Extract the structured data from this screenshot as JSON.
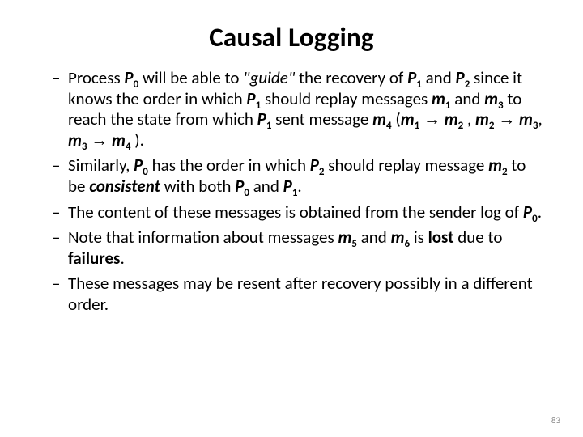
{
  "title": "Causal Logging",
  "bullets": [
    {
      "t": [
        "Process ",
        "<b><i>P</i></b>",
        "<span class=\"sub\"><b>0</b></span>",
        " will be able to ",
        "<i>\"guide\"</i>",
        " the recovery of ",
        "<b><i>P</i></b>",
        "<span class=\"sub\"><b>1</b></span>",
        " and ",
        "<b><i>P</i></b>",
        "<span class=\"sub\"><b>2</b></span>",
        " since it knows the order in which ",
        "<b><i>P</i></b>",
        "<span class=\"sub\"><b>1</b></span>",
        " should replay messages ",
        "<b><i>m</i></b>",
        "<span class=\"sub\"><b>1</b></span>",
        " and ",
        "<b><i>m</i></b>",
        "<span class=\"sub\"><b>3</b></span>",
        " to reach the state from which ",
        "<b><i>P</i></b>",
        "<span class=\"sub\"><b>1</b></span>",
        " sent message ",
        "<b><i>m</i></b>",
        "<span class=\"sub\"><b>4</b></span>",
        " (",
        "<b><i>m</i></b>",
        "<span class=\"sub\"><b>1</b></span>",
        " <span class=\"arrow\">→</span> ",
        "<b><i>m</i></b>",
        "<span class=\"sub\"><b>2</b></span>",
        " , ",
        "<b><i>m</i></b>",
        "<span class=\"sub\"><b>2</b></span>",
        " <span class=\"arrow\">→</span> ",
        "<b><i>m</i></b>",
        "<span class=\"sub\"><b>3</b></span>",
        ", ",
        "<b><i>m</i></b>",
        "<span class=\"sub\"><b>3</b></span>",
        " <span class=\"arrow\">→</span> ",
        "<b><i>m</i></b>",
        "<span class=\"sub\"><b>4</b></span>",
        " )."
      ]
    },
    {
      "t": [
        "Similarly, ",
        "<b><i>P</i></b>",
        "<span class=\"sub\"><b>0</b></span>",
        " has the order in which ",
        "<b><i>P</i></b>",
        "<span class=\"sub\"><b>2</b></span>",
        " should replay message ",
        "<b><i>m</i></b>",
        "<span class=\"sub\"><b>2</b></span>",
        " to be ",
        "<b><i>consistent</i></b>",
        " with both ",
        "<b><i>P</i></b>",
        "<span class=\"sub\"><b>0</b></span>",
        " and ",
        "<b><i>P</i></b>",
        "<span class=\"sub\"><b>1</b></span>",
        "."
      ]
    },
    {
      "t": [
        "The content of these messages is obtained from the sender log of ",
        "<b><i>P</i></b>",
        "<span class=\"sub\"><b>0</b></span>",
        "."
      ]
    },
    {
      "t": [
        "Note that information about messages ",
        "<b><i>m</i></b>",
        "<span class=\"sub\"><b>5</b></span>",
        " and ",
        "<b><i>m</i></b>",
        "<span class=\"sub\"><b>6</b></span>",
        " is ",
        "<b>lost</b>",
        " due to ",
        "<b>failures</b>",
        "."
      ]
    },
    {
      "t": [
        "These messages may be resent after recovery possibly in a different order."
      ]
    }
  ],
  "pagenum": "83"
}
